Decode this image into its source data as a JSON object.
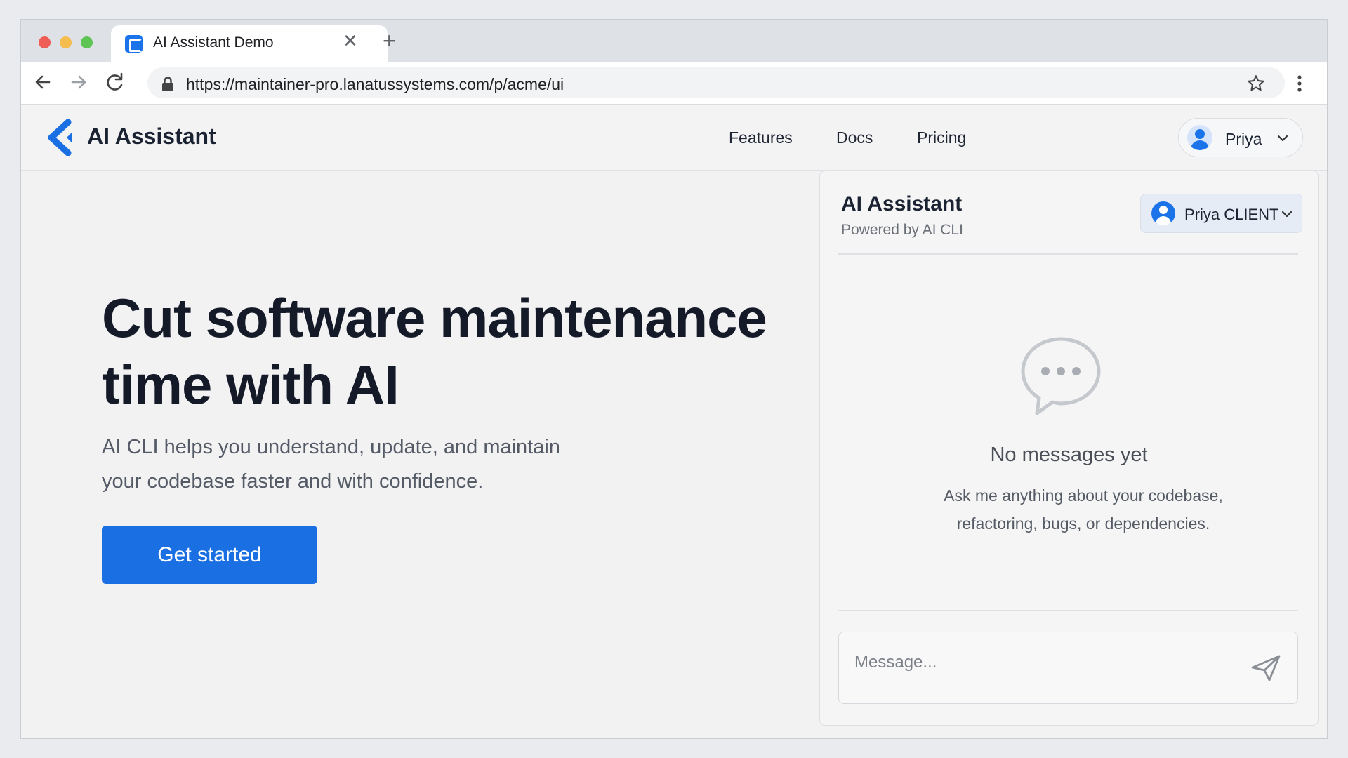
{
  "browser": {
    "tab_title": "AI Assistant Demo",
    "url": "https://maintainer-pro.lanatussystems.com/p/acme/ui"
  },
  "site": {
    "brand": "AI Assistant",
    "nav": [
      "Features",
      "Docs",
      "Pricing"
    ],
    "user": "Priya"
  },
  "hero": {
    "title_line1": "Cut software maintenance",
    "title_line2": "time with AI",
    "subtitle_line1": "AI CLI helps you understand, update, and maintain",
    "subtitle_line2": "your codebase faster and with confidence.",
    "cta_label": "Get started"
  },
  "chat": {
    "title": "AI Assistant",
    "subtitle": "Powered by AI CLI",
    "client_label": "Priya CLIENT",
    "empty_title": "No messages yet",
    "empty_desc_line1": "Ask me anything about your codebase,",
    "empty_desc_line2": "refactoring, bugs, or dependencies.",
    "input_placeholder": "Message..."
  },
  "colors": {
    "accent": "#1a6fe3",
    "text_dark": "#151a29",
    "traffic_red": "#ee5e57",
    "traffic_yellow": "#f5bd4f",
    "traffic_green": "#5ec454"
  },
  "icons": [
    "tab-favicon-icon",
    "close-icon",
    "plus-icon",
    "back-arrow-icon",
    "forward-arrow-icon",
    "reload-icon",
    "lock-icon",
    "star-icon",
    "kebab-menu-icon",
    "logo-chevron-icon",
    "user-avatar-icon",
    "chevron-down-icon",
    "chat-bubble-icon",
    "send-icon"
  ]
}
